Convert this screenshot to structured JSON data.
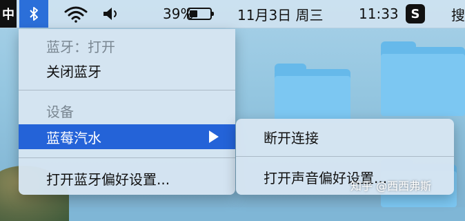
{
  "menubar": {
    "input_method": "中",
    "battery_percent": "39%",
    "battery_level": 0.39,
    "date": "11月3日 周三",
    "time": "11:33",
    "sogou_label": "S",
    "search_partial": "搜",
    "icons": [
      "bluetooth-icon",
      "wifi-icon",
      "volume-icon",
      "battery-icon"
    ]
  },
  "bluetooth_menu": {
    "status": "蓝牙：打开",
    "turn_off": "关闭蓝牙",
    "devices_header": "设备",
    "device_name": "蓝莓汽水",
    "open_prefs": "打开蓝牙偏好设置..."
  },
  "device_submenu": {
    "disconnect": "断开连接",
    "open_sound_prefs": "打开声音偏好设置..."
  },
  "watermark": "知乎 @西西弗斯",
  "colors": {
    "highlight": "#2463d8",
    "bluetooth_active": "#2b6fd9"
  }
}
